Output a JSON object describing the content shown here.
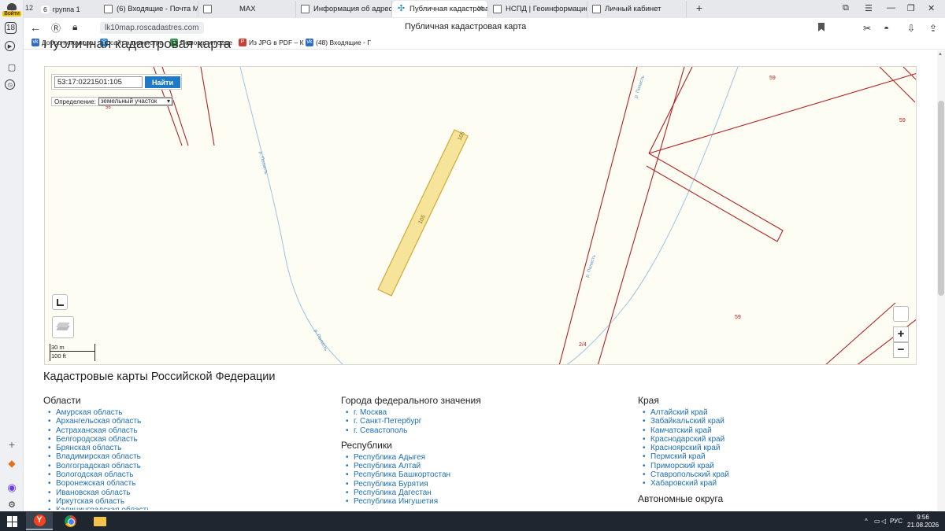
{
  "browser": {
    "sidebar": {
      "login": "Войти",
      "count": "18"
    },
    "tab_count": "12",
    "tab_group": {
      "count": "6",
      "label": "группа 1"
    },
    "tabs": [
      {
        "title": "(6) Входящие - Почта Ма"
      },
      {
        "title": "MAX"
      },
      {
        "title": "Информация об адресе"
      },
      {
        "title": "Публичная кадастровая"
      },
      {
        "title": "НСПД | Геоинформацион"
      },
      {
        "title": "Личный кабинет"
      }
    ],
    "url": "lk10map.roscadastres.com",
    "page_title": "Публичная кадастровая карта",
    "bookmarks": [
      {
        "label": "Добро пожалова",
        "color": "#2d6ec4",
        "glyph": "vk"
      },
      {
        "label": "сайт администра",
        "color": "#2e8ad6",
        "glyph": "◎"
      },
      {
        "label": "Помощь и подде",
        "color": "#3b9a52",
        "glyph": "♦"
      },
      {
        "label": "Из JPG в PDF – К",
        "color": "#d23a2f",
        "glyph": "P"
      },
      {
        "label": "(48) Входящие - Г",
        "color": "#2d6ec4",
        "glyph": "vk"
      }
    ]
  },
  "page": {
    "header": "Публичная кадастровая карта",
    "search": {
      "value": "53:17:0221501:105",
      "button": "Найти"
    },
    "definition": {
      "label": "Определение:",
      "selected": "земельный участок"
    },
    "map_labels": {
      "parcel": "105",
      "river": "р. Полисть",
      "parcel_59": "59",
      "parcel_2_4": "2/4",
      "parcel_56": "56"
    },
    "scale": {
      "metric": "30 m",
      "imperial": "100 ft"
    },
    "zoom": {
      "in": "+",
      "out": "−"
    },
    "section_title": "Кадастровые карты Российской Федерации",
    "columns": [
      {
        "title": "Области",
        "items": [
          "Амурская область",
          "Архангельская область",
          "Астраханская область",
          "Белгородская область",
          "Брянская область",
          "Владимирская область",
          "Волгоградская область",
          "Вологодская область",
          "Воронежская область",
          "Ивановская область",
          "Иркутская область",
          "Калининградская область"
        ]
      },
      {
        "title": "Города федерального значения",
        "items": [
          "г. Москва",
          "г. Санкт-Петербург",
          "г. Севастополь"
        ]
      },
      {
        "title": "Республики",
        "items": [
          "Республика Адыгея",
          "Республика Алтай",
          "Республика Башкортостан",
          "Республика Бурятия",
          "Республика Дагестан",
          "Республика Ингушетия"
        ]
      },
      {
        "title": "Края",
        "items": [
          "Алтайский край",
          "Забайкальский край",
          "Камчатский край",
          "Краснодарский край",
          "Красноярский край",
          "Пермский край",
          "Приморский край",
          "Ставропольский край",
          "Хабаровский край"
        ]
      },
      {
        "title": "Автономные округа",
        "items": []
      }
    ]
  },
  "taskbar": {
    "lang": "РУС",
    "time": "9:56",
    "date": "21.08.2026"
  }
}
